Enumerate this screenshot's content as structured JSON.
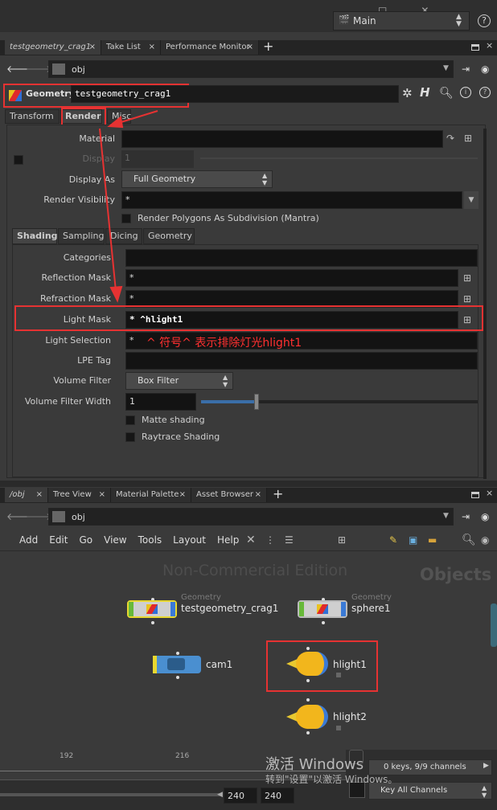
{
  "titlebar": {
    "desktop": "Main",
    "help": "?"
  },
  "top_tabs": [
    "testgeometry_crag1",
    "Take List",
    "Performance Monitor"
  ],
  "path1": "obj",
  "node": {
    "type": "Geometry",
    "name": "testgeometry_crag1"
  },
  "param_tabs": [
    "Transform",
    "Render",
    "Misc"
  ],
  "params": {
    "material_label": "Material",
    "material_value": "",
    "display_label": "Display",
    "display_value": "1",
    "display_as_label": "Display As",
    "display_as_value": "Full Geometry",
    "render_vis_label": "Render Visibility",
    "render_vis_value": "*",
    "subdiv_label": "Render Polygons As Subdivision (Mantra)"
  },
  "sub_tabs": [
    "Shading",
    "Sampling",
    "Dicing",
    "Geometry"
  ],
  "shading": {
    "categories_label": "Categories",
    "categories_value": "",
    "reflection_label": "Reflection Mask",
    "reflection_value": "*",
    "refraction_label": "Refraction Mask",
    "refraction_value": "*",
    "light_mask_label": "Light Mask",
    "light_mask_value": "* ^hlight1",
    "light_sel_label": "Light Selection",
    "light_sel_value": "*",
    "lpe_label": "LPE Tag",
    "lpe_value": "",
    "vol_filter_label": "Volume Filter",
    "vol_filter_value": "Box Filter",
    "vol_width_label": "Volume Filter Width",
    "vol_width_value": "1",
    "matte_label": "Matte shading",
    "raytrace_label": "Raytrace Shading"
  },
  "annotation": "^ 符号^ 表示排除灯光hlight1",
  "bottom_tabs": [
    "/obj",
    "Tree View",
    "Material Palette",
    "Asset Browser"
  ],
  "path2": "obj",
  "menu": [
    "Add",
    "Edit",
    "Go",
    "View",
    "Tools",
    "Layout",
    "Help"
  ],
  "network": {
    "watermark": "Non-Commercial Edition",
    "context": "Objects",
    "nodes": [
      {
        "type": "Geometry",
        "name": "testgeometry_crag1"
      },
      {
        "type": "Geometry",
        "name": "sphere1"
      },
      {
        "type": "",
        "name": "cam1"
      },
      {
        "type": "",
        "name": "hlight1"
      },
      {
        "type": "",
        "name": "hlight2"
      }
    ]
  },
  "timeline": {
    "tick1": "192",
    "tick2": "216",
    "frame1": "240",
    "frame2": "240",
    "keys": "0 keys, 9/9 channels",
    "key_all": "Key All Channels"
  },
  "activation": {
    "line1": "激活 Windows",
    "line2": "转到\"设置\"以激活 Windows。"
  },
  "colors": {
    "highlight": "#e63232",
    "bg": "#3a3a3a",
    "field": "#131313",
    "annotation": "#ff3030"
  }
}
